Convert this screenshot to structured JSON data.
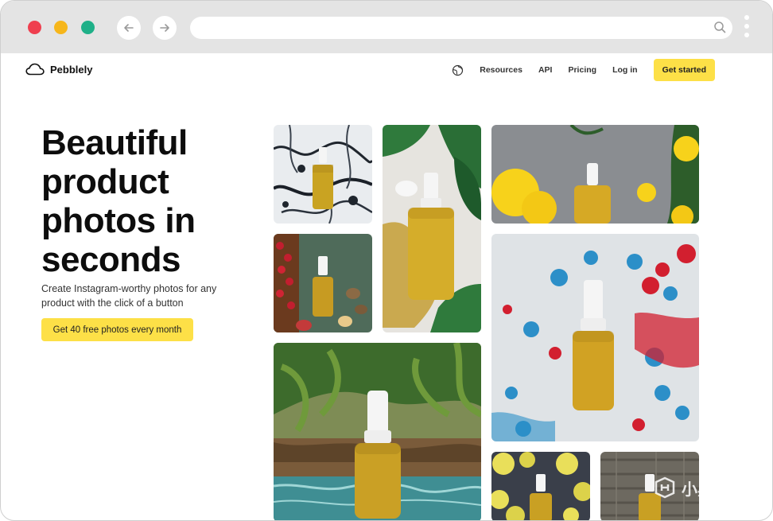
{
  "browser": {
    "buttons": {
      "back": "arrow-left-icon",
      "forward": "arrow-right-icon"
    },
    "url": ""
  },
  "header": {
    "brand": "Pebblely",
    "nav": [
      "Resources",
      "API",
      "Pricing",
      "Log in"
    ],
    "cta": "Get started"
  },
  "hero": {
    "title": "Beautiful product photos in seconds",
    "subtitle": "Create Instagram-worthy photos for any product with the click of a button",
    "cta": "Get 40 free photos every month"
  },
  "gallery": {
    "images": [
      "serum-on-marble",
      "serum-on-monstera-leaves",
      "serum-on-stone-with-yellow-flowers",
      "serum-with-berries-and-nuts",
      "serum-on-paint-splatters",
      "serum-in-tropical-pool",
      "serum-on-yellow-leaves",
      "serum-on-wood"
    ]
  },
  "watermark": "小黑盒",
  "colors": {
    "accent": "#fde047",
    "chrome": "#e4e4e4",
    "dot_red": "#ef3f4f",
    "dot_yellow": "#f6b61b",
    "dot_green": "#1fb088"
  }
}
